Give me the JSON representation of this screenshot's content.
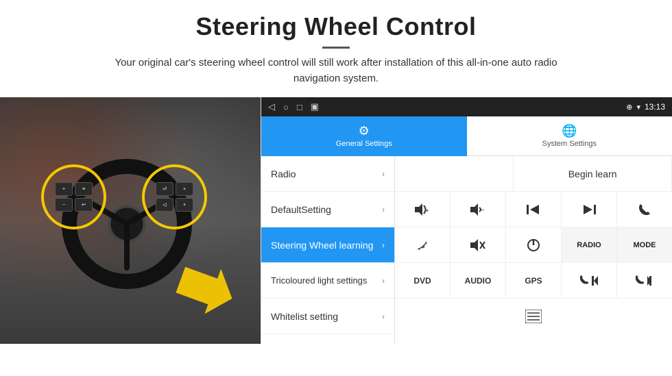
{
  "header": {
    "title": "Steering Wheel Control",
    "subtitle": "Your original car's steering wheel control will still work after installation of this all-in-one auto radio navigation system."
  },
  "statusBar": {
    "time": "13:13",
    "icons": [
      "◁",
      "○",
      "□",
      "▣"
    ]
  },
  "tabs": [
    {
      "id": "general",
      "label": "General Settings",
      "active": true
    },
    {
      "id": "system",
      "label": "System Settings",
      "active": false
    }
  ],
  "menuItems": [
    {
      "id": "radio",
      "label": "Radio",
      "active": false
    },
    {
      "id": "defaultsetting",
      "label": "DefaultSetting",
      "active": false
    },
    {
      "id": "steering",
      "label": "Steering Wheel learning",
      "active": true
    },
    {
      "id": "tricoloured",
      "label": "Tricoloured light settings",
      "active": false
    },
    {
      "id": "whitelist",
      "label": "Whitelist setting",
      "active": false
    }
  ],
  "controls": {
    "beginLearn": "Begin learn",
    "row2": [
      "🔊＋",
      "🔉－",
      "⏮",
      "⏭",
      "📞"
    ],
    "row3": [
      "↪",
      "🔊✕",
      "⏻",
      "RADIO",
      "MODE"
    ],
    "row4": [
      "DVD",
      "AUDIO",
      "GPS",
      "📞⏮",
      "📞⏭"
    ],
    "row5": [
      "📋"
    ]
  }
}
